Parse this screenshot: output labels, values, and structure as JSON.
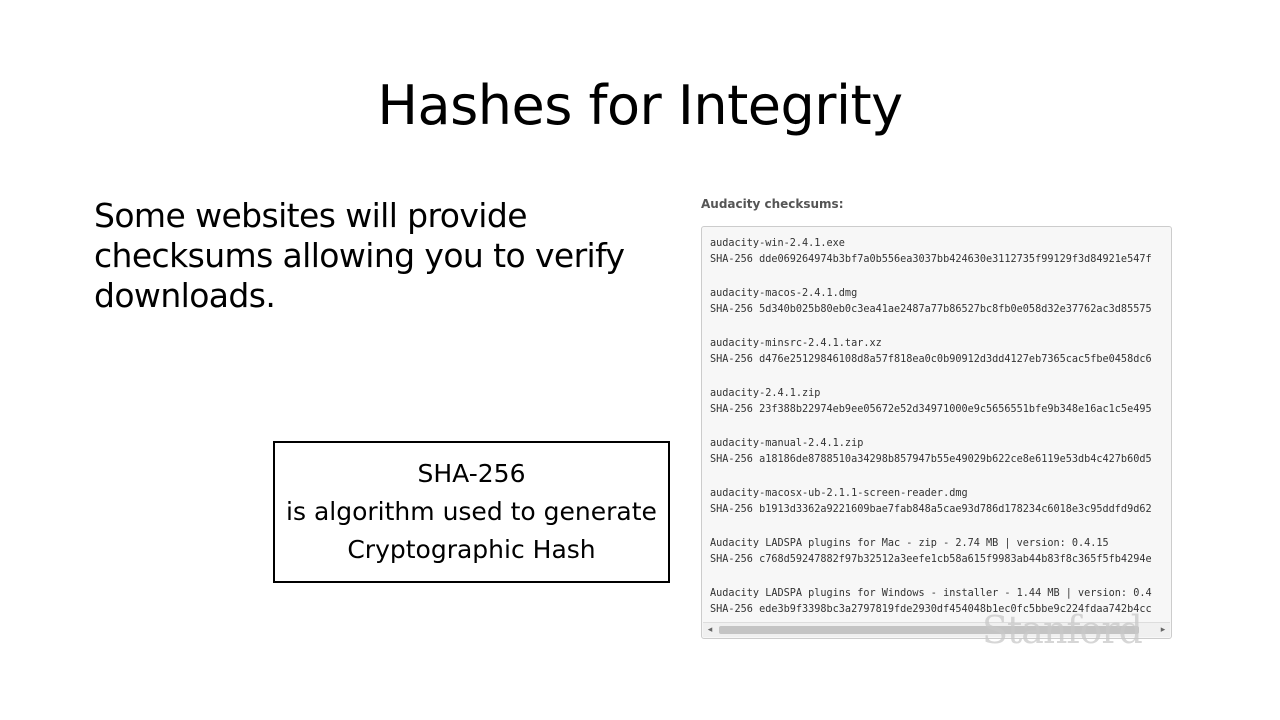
{
  "slide": {
    "title": "Hashes for Integrity",
    "intro": "Some websites will provide checksums allowing you to verify downloads.",
    "callout": {
      "line1": "SHA-256",
      "line2": "is algorithm used to generate",
      "line3": "Cryptographic Hash"
    },
    "watermark": "Stanford"
  },
  "checksums": {
    "label": "Audacity checksums:",
    "entries": [
      {
        "file": "audacity-win-2.4.1.exe",
        "hash": "SHA-256 dde069264974b3bf7a0b556ea3037bb424630e3112735f99129f3d84921e547f"
      },
      {
        "file": "audacity-macos-2.4.1.dmg",
        "hash": "SHA-256 5d340b025b80eb0c3ea41ae2487a77b86527bc8fb0e058d32e37762ac3d85575"
      },
      {
        "file": "audacity-minsrc-2.4.1.tar.xz",
        "hash": "SHA-256 d476e25129846108d8a57f818ea0c0b90912d3dd4127eb7365cac5fbe0458dc6"
      },
      {
        "file": "audacity-2.4.1.zip",
        "hash": "SHA-256 23f388b22974eb9ee05672e52d34971000e9c5656551bfe9b348e16ac1c5e495"
      },
      {
        "file": "audacity-manual-2.4.1.zip",
        "hash": "SHA-256 a18186de8788510a34298b857947b55e49029b622ce8e6119e53db4c427b60d5"
      },
      {
        "file": "audacity-macosx-ub-2.1.1-screen-reader.dmg",
        "hash": "SHA-256 b1913d3362a9221609bae7fab848a5cae93d786d178234c6018e3c95ddfd9d62"
      },
      {
        "file": "Audacity LADSPA plugins for Mac - zip - 2.74 MB | version: 0.4.15",
        "hash": "SHA-256 c768d59247882f97b32512a3eefe1cb58a615f9983ab44b83f8c365f5fb4294e"
      },
      {
        "file": "Audacity LADSPA plugins for Windows - installer - 1.44 MB | version: 0.4",
        "hash": "SHA-256 ede3b9f3398bc3a2797819fde2930df454048b1ec0fc5bbe9c224fdaa742b4cc"
      }
    ],
    "scroll_left_icon": "◂",
    "scroll_right_icon": "▸"
  }
}
